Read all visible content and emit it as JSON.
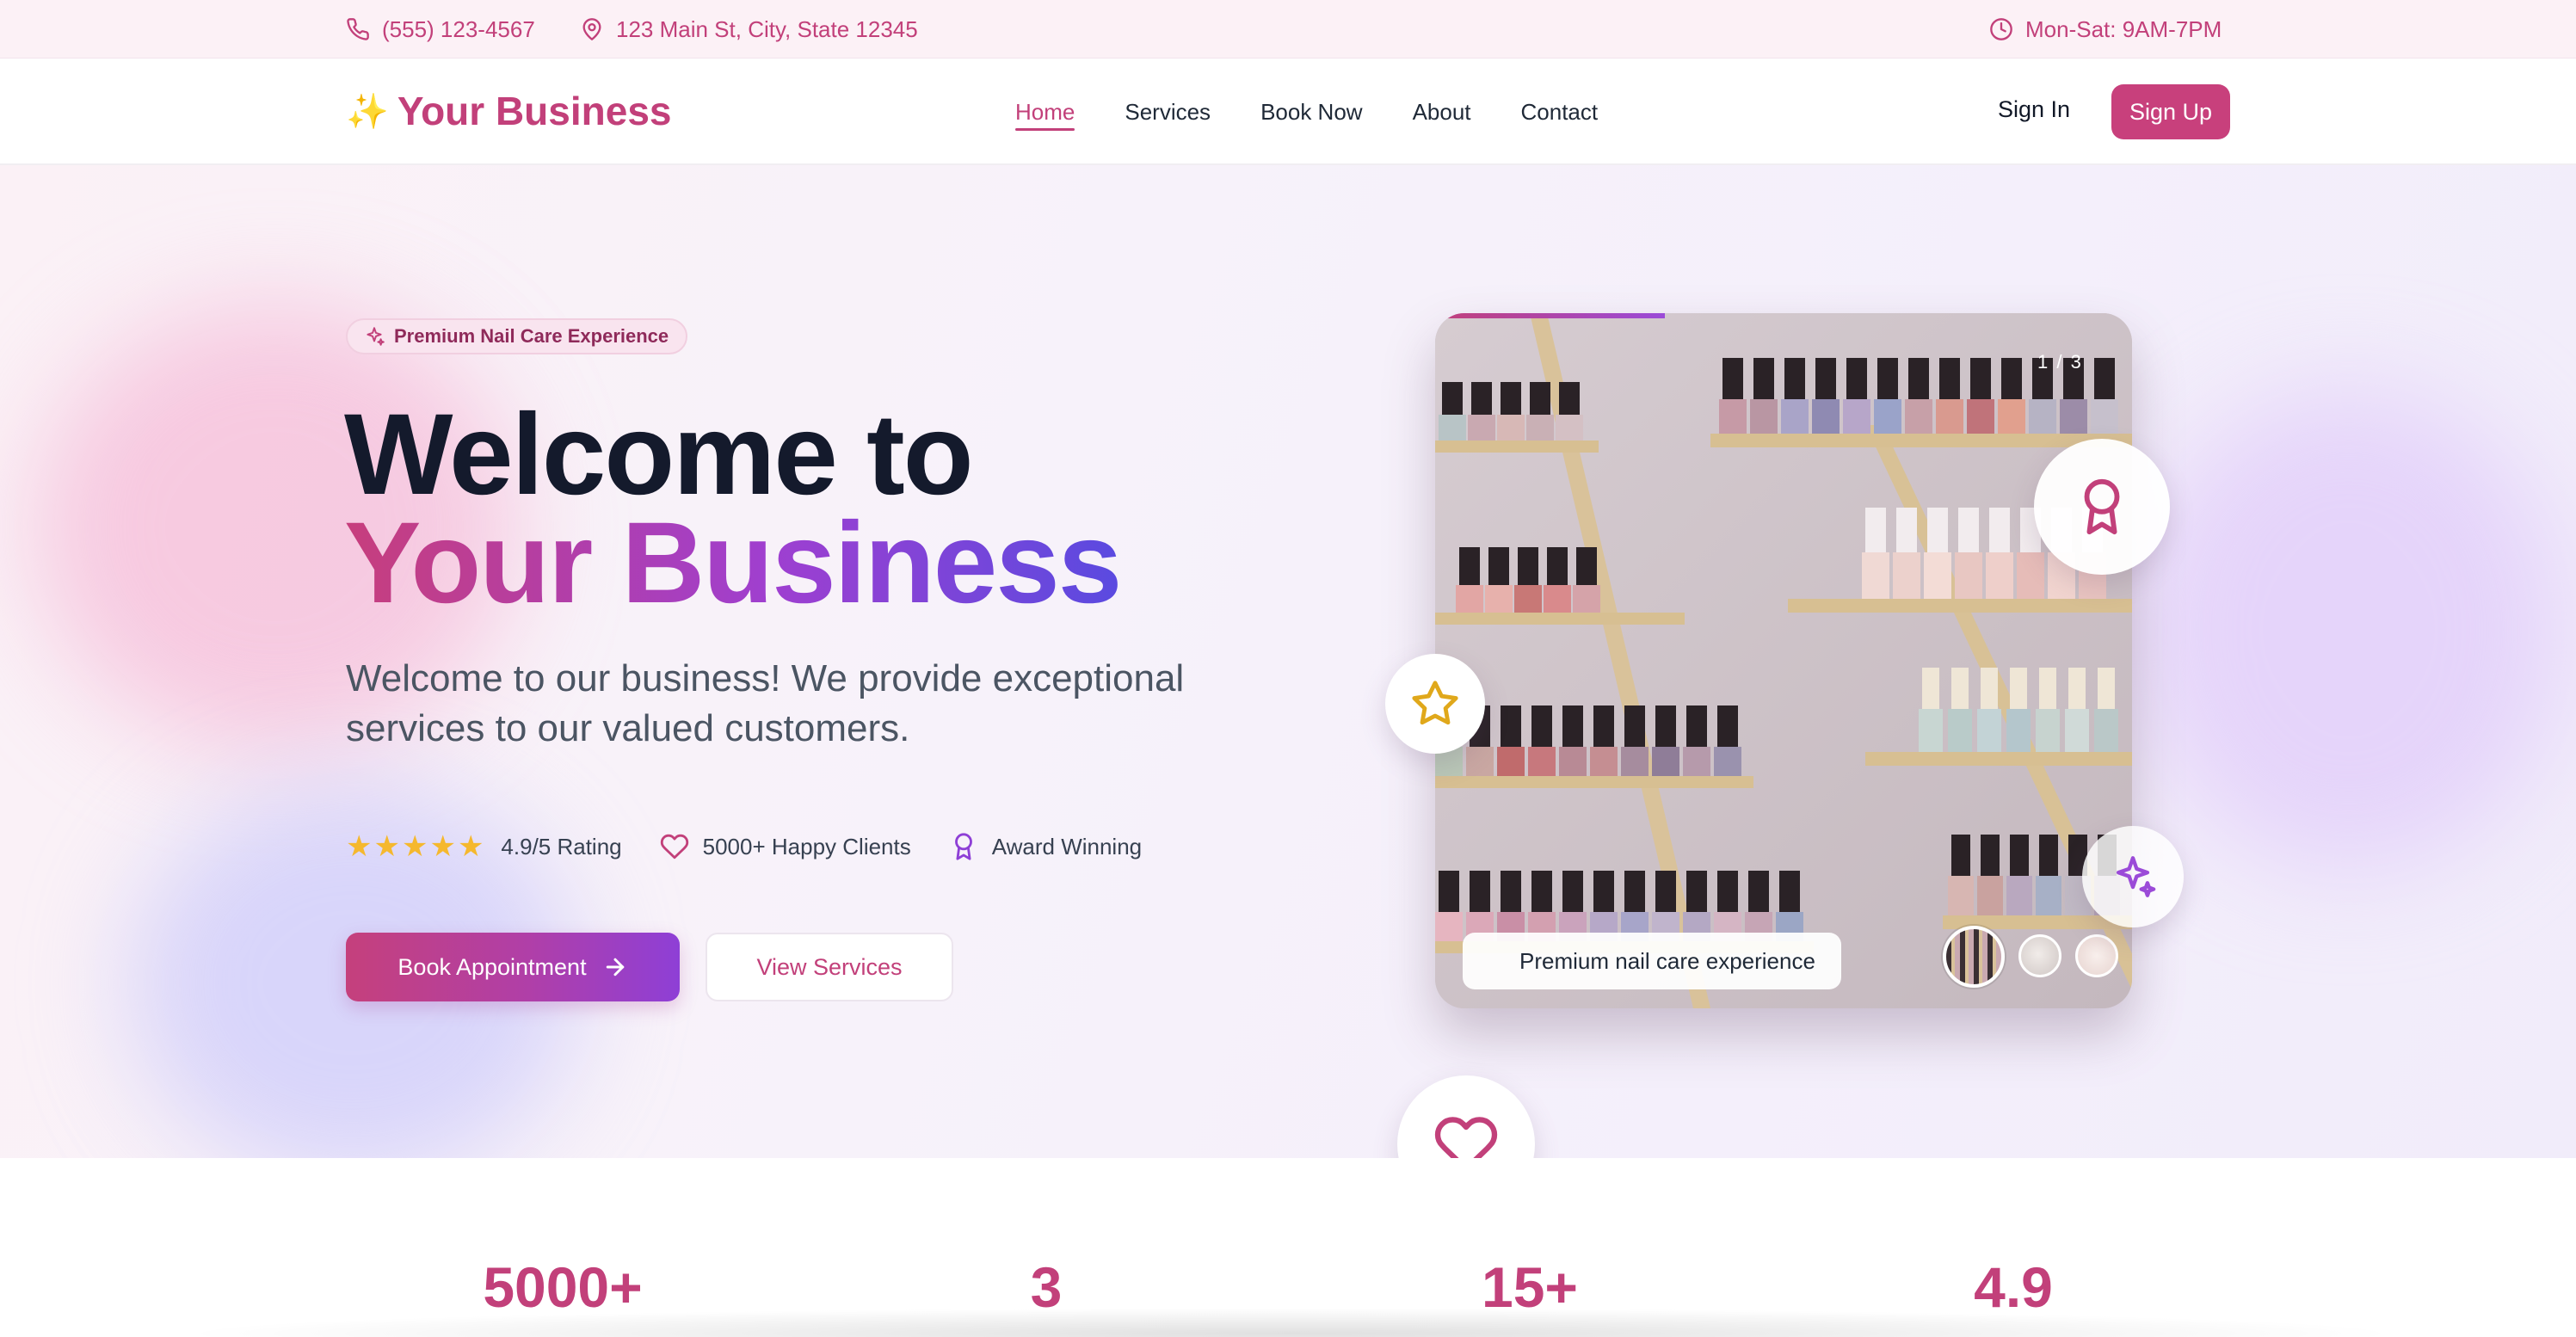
{
  "topbar": {
    "phone": "(555) 123-4567",
    "address": "123 Main St, City, State 12345",
    "hours": "Mon-Sat: 9AM-7PM"
  },
  "nav": {
    "brand_icon": "✨",
    "brand": "Your Business",
    "links": [
      {
        "label": "Home",
        "active": true
      },
      {
        "label": "Services"
      },
      {
        "label": "Book Now"
      },
      {
        "label": "About"
      },
      {
        "label": "Contact"
      }
    ],
    "signin": "Sign In",
    "signup": "Sign Up"
  },
  "hero": {
    "badge": "Premium Nail Care Experience",
    "title_line1": "Welcome to",
    "title_line2": "Your Business",
    "subtitle": "Welcome to our business! We provide exceptional services to our valued customers.",
    "rating": "4.9/5 Rating",
    "clients": "5000+ Happy Clients",
    "award": "Award Winning",
    "book_button": "Book Appointment",
    "services_button": "View Services"
  },
  "carousel": {
    "caption": "Premium nail care experience",
    "counter": "1 / 3",
    "progress": 0.33,
    "slides": 3
  },
  "stats": [
    "5000+",
    "3",
    "15+",
    "4.9"
  ],
  "colors": {
    "brand": "#c2407a",
    "accent_purple": "#8e3fd6",
    "star": "#f5b82e"
  },
  "icons": [
    "phone-icon",
    "map-pin-icon",
    "clock-icon",
    "sparkles-icon",
    "star-icon",
    "heart-icon",
    "award-icon",
    "arrow-right-icon"
  ]
}
